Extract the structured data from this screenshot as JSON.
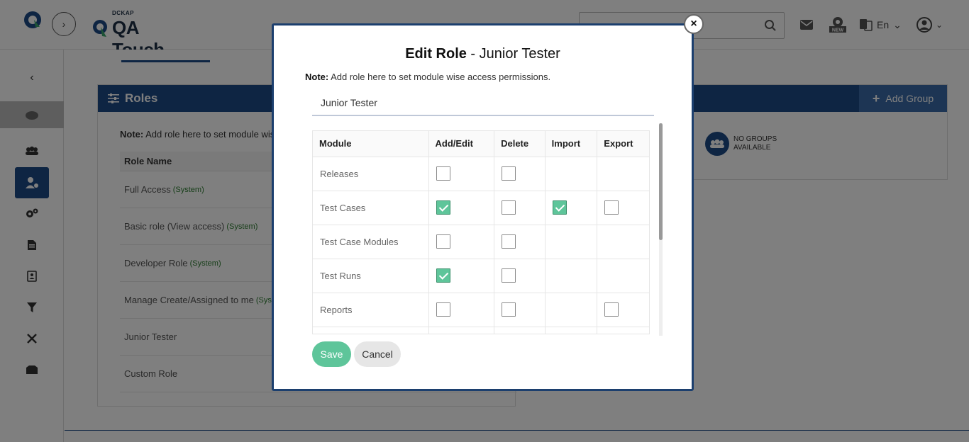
{
  "header": {
    "brand_small": "DCKAP",
    "brand_name": "QA Touch",
    "lang": "En"
  },
  "roles_panel": {
    "title": "Roles",
    "note_label": "Note:",
    "note_text": "Add role here to set module wise access permissions.",
    "column_header": "Role Name",
    "roles": [
      {
        "name": "Full Access",
        "tag": "(System)"
      },
      {
        "name": "Basic role (View access)",
        "tag": "(System)"
      },
      {
        "name": "Developer Role",
        "tag": "(System)"
      },
      {
        "name": "Manage Create/Assigned to me",
        "tag": "(System)"
      },
      {
        "name": "Junior Tester",
        "tag": ""
      },
      {
        "name": "Custom Role",
        "tag": ""
      }
    ]
  },
  "groups_panel": {
    "add_label": "Add Group",
    "empty_line1": "NO GROUPS",
    "empty_line2": "AVAILABLE"
  },
  "modal": {
    "title_bold": "Edit Role",
    "title_sep": " - ",
    "title_role": "Junior Tester",
    "note_label": "Note:",
    "note_text": " Add role here to set module wise access permissions.",
    "role_name_value": "Junior Tester",
    "save_label": "Save",
    "cancel_label": "Cancel",
    "columns": [
      "Module",
      "Add/Edit",
      "Delete",
      "Import",
      "Export"
    ],
    "rows": [
      {
        "module": "Releases",
        "add_edit": false,
        "delete": false,
        "import": null,
        "export": null
      },
      {
        "module": "Test Cases",
        "add_edit": true,
        "delete": false,
        "import": true,
        "export": false
      },
      {
        "module": "Test Case Modules",
        "add_edit": false,
        "delete": false,
        "import": null,
        "export": null
      },
      {
        "module": "Test Runs",
        "add_edit": true,
        "delete": false,
        "import": null,
        "export": null
      },
      {
        "module": "Reports",
        "add_edit": false,
        "delete": false,
        "import": null,
        "export": false
      }
    ]
  },
  "colors": {
    "primary": "#1c4a86",
    "success": "#5ec59a"
  }
}
